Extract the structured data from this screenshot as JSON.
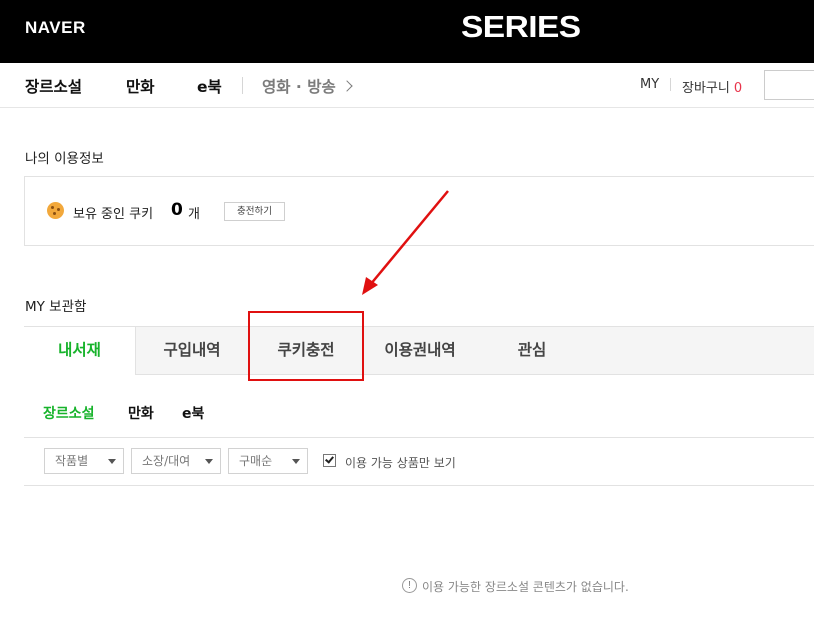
{
  "header": {
    "naver_logo": "NAVER",
    "series_logo": "SERIES"
  },
  "nav": {
    "items": [
      "장르소설",
      "만화",
      "e북"
    ],
    "more_label": "영화 · 방송",
    "my_label": "MY",
    "cart_label": "장바구니",
    "cart_count": "0"
  },
  "info": {
    "title": "나의 이용정보",
    "cookie_label": "보유 중인 쿠키",
    "cookie_count": "0",
    "cookie_unit": "개",
    "charge_button": "충전하기"
  },
  "storage": {
    "title": "MY 보관함",
    "tabs": [
      "내서재",
      "구입내역",
      "쿠키충전",
      "이용권내역",
      "관심"
    ],
    "active_tab": "내서재",
    "subtabs": [
      "장르소설",
      "만화",
      "e북"
    ],
    "active_subtab": "장르소설",
    "filters": [
      "작품별",
      "소장/대여",
      "구매순"
    ],
    "only_available_label": "이용 가능 상품만 보기",
    "only_available_checked": true,
    "empty_message": "이용 가능한 장르소설 콘텐츠가 없습니다."
  },
  "annotation": {
    "color": "#e01010",
    "highlighted_tab": "쿠키충전"
  },
  "colors": {
    "accent_green": "#17b32b",
    "cart_count_red": "#e8334a"
  }
}
